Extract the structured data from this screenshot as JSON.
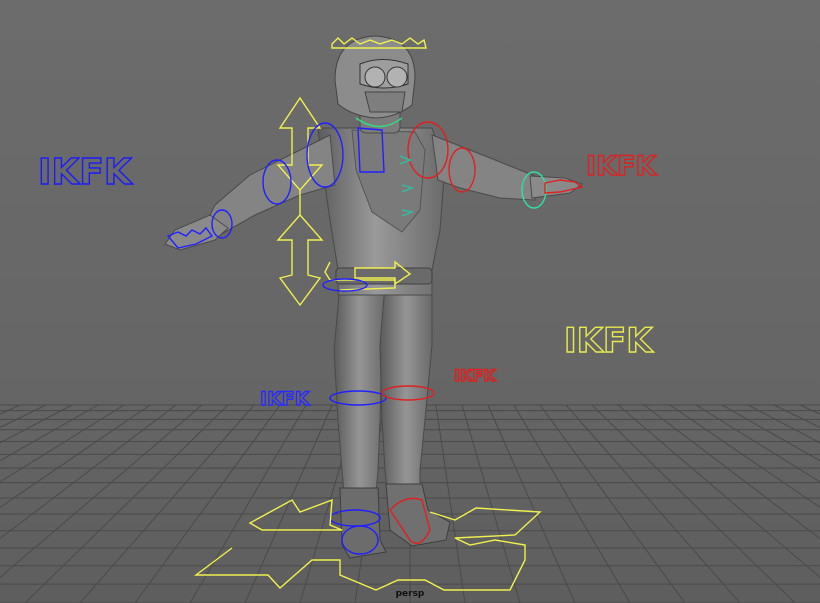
{
  "viewport": {
    "camera_name": "persp",
    "background_color": "#676767"
  },
  "controls": {
    "ikfk_labels": [
      {
        "text": "IKFK",
        "side": "left-arm",
        "color": "#1a1aff"
      },
      {
        "text": "IKFK",
        "side": "right-arm",
        "color": "#e02020"
      },
      {
        "text": "IKFK",
        "side": "right-leg",
        "color": "#e8e850"
      },
      {
        "text": "IKFK",
        "side": "left-leg",
        "color": "#2a2aff"
      },
      {
        "text": "IKFK",
        "side": "right-leg-small",
        "color": "#e02020"
      }
    ],
    "colors": {
      "left_side": "#2020ff",
      "right_side": "#e02020",
      "center": "#f0f050",
      "cog": "#30e0a0",
      "mesh": "#8a8a8a"
    }
  }
}
